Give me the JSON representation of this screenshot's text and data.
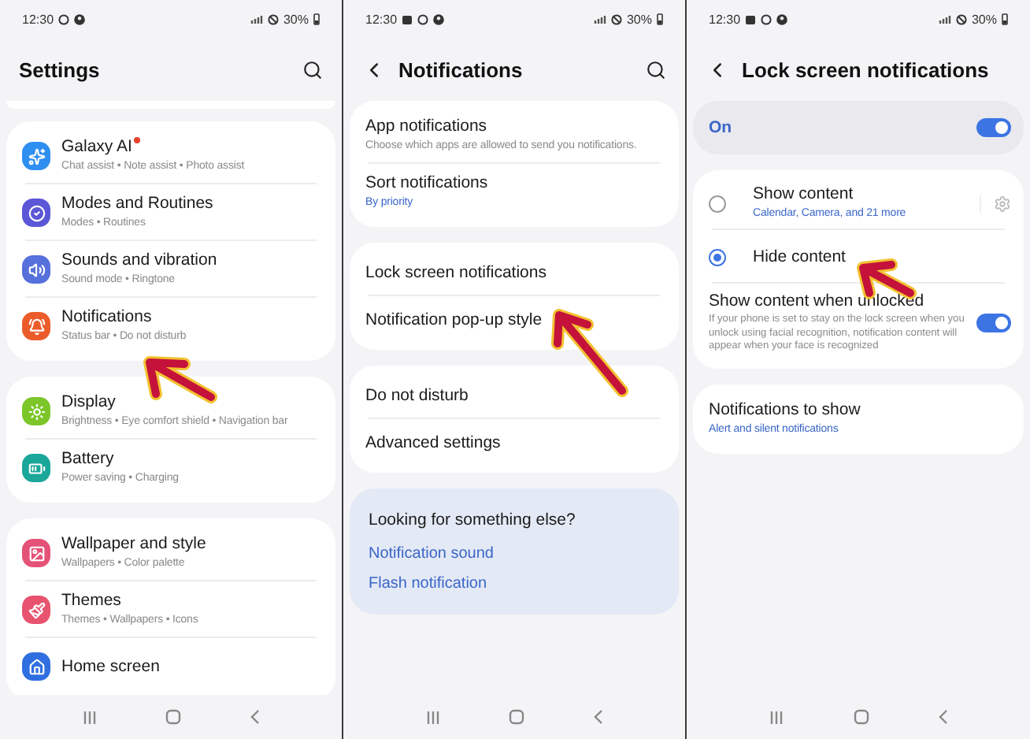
{
  "panels": [
    {
      "kind": "settings",
      "status": {
        "time": "12:30",
        "battery": "30%"
      },
      "title": "Settings",
      "search": true,
      "scroll_edge": true,
      "groups": [
        {
          "kind": "card",
          "items": [
            {
              "kind": "setting",
              "title": "Galaxy AI",
              "new_badge": true,
              "subtitle": "Chat assist • Note assist • Photo assist",
              "color": "#2e8ff0"
            },
            {
              "kind": "setting",
              "title": "Modes and Routines",
              "new_badge": false,
              "subtitle": "Modes • Routines",
              "color": "#5b57d6"
            },
            {
              "kind": "setting",
              "title": "Sounds and vibration",
              "new_badge": false,
              "subtitle": "Sound mode • Ringtone",
              "color": "#5670dc"
            },
            {
              "kind": "setting",
              "title": "Notifications",
              "new_badge": false,
              "subtitle": "Status bar • Do not disturb",
              "color": "#ec5c2a"
            }
          ]
        },
        {
          "kind": "card",
          "items": [
            {
              "kind": "setting",
              "title": "Display",
              "new_badge": false,
              "subtitle": "Brightness • Eye comfort shield • Navigation bar",
              "color": "#7cc62a"
            },
            {
              "kind": "setting",
              "title": "Battery",
              "new_badge": false,
              "subtitle": "Power saving • Charging",
              "color": "#1aa79a"
            }
          ]
        },
        {
          "kind": "card",
          "items": [
            {
              "kind": "setting",
              "title": "Wallpaper and style",
              "new_badge": false,
              "subtitle": "Wallpapers • Color palette",
              "color": "#e55277"
            },
            {
              "kind": "setting",
              "title": "Themes",
              "new_badge": false,
              "subtitle": "Themes • Wallpapers • Icons",
              "color": "#e8546f"
            },
            {
              "kind": "setting",
              "title": "Home screen",
              "new_badge": false,
              "color": "#2f6fe0"
            }
          ]
        }
      ]
    },
    {
      "kind": "notifications",
      "status": {
        "time": "12:30",
        "battery": "30%"
      },
      "title": "Notifications",
      "back": true,
      "search": true,
      "groups": [
        {
          "kind": "card",
          "items": [
            {
              "kind": "setting",
              "title": "App notifications",
              "subtitle": "Choose which apps are allowed to send you notifications."
            },
            {
              "kind": "setting",
              "title": "Sort notifications",
              "subtitle": "By priority",
              "accent": true
            }
          ]
        },
        {
          "kind": "card",
          "items": [
            {
              "kind": "setting",
              "title": "Lock screen notifications"
            },
            {
              "kind": "setting",
              "title": "Notification pop-up style"
            }
          ]
        },
        {
          "kind": "card",
          "items": [
            {
              "kind": "setting",
              "title": "Do not disturb"
            },
            {
              "kind": "setting",
              "title": "Advanced settings"
            }
          ]
        },
        {
          "kind": "suggestions",
          "items": [
            {
              "kind": "heading",
              "title": "Looking for something else?"
            },
            {
              "kind": "link",
              "title": "Notification sound"
            },
            {
              "kind": "link",
              "title": "Flash notification"
            }
          ]
        }
      ]
    },
    {
      "kind": "lockscreen",
      "status": {
        "time": "12:30",
        "battery": "30%"
      },
      "title": "Lock screen notifications",
      "back": true,
      "groups": [
        {
          "kind": "master",
          "items": [
            {
              "kind": "master_switch",
              "title": "On",
              "on": true
            }
          ]
        },
        {
          "kind": "card",
          "items": [
            {
              "kind": "radio",
              "title": "Show content",
              "subtitle": "Calendar, Camera, and 21 more",
              "accent": true,
              "selected": false,
              "gear": true
            },
            {
              "kind": "radio",
              "title": "Hide content",
              "selected": true,
              "gear": false
            },
            {
              "kind": "switch",
              "title": "Show content when unlocked",
              "subtitle": "If your phone is set to stay on the lock screen when you unlock using facial recognition, notification content will appear when your face is recognized",
              "on": true
            }
          ]
        },
        {
          "kind": "card",
          "items": [
            {
              "kind": "setting",
              "title": "Notifications to show",
              "subtitle": "Alert and silent notifications",
              "accent": true
            }
          ]
        }
      ]
    }
  ]
}
